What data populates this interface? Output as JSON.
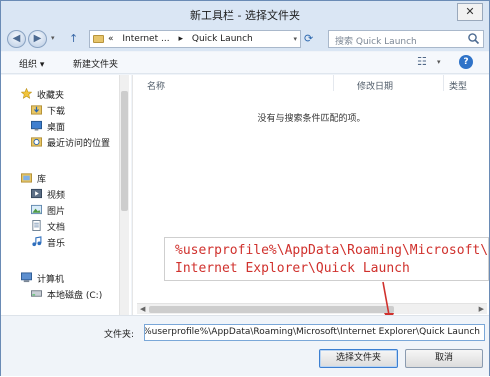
{
  "window": {
    "title": "新工具栏 - 选择文件夹",
    "close_glyph": "✕"
  },
  "address": {
    "crumbs": [
      "«",
      "Internet ...",
      "▸",
      "Quick Launch"
    ],
    "dropdown_glyph": "▾"
  },
  "search": {
    "placeholder": "搜索 Quick Launch"
  },
  "toolbar": {
    "organize": "组织 ▾",
    "new_folder": "新建文件夹",
    "view_glyph": "☷",
    "view_drop": "▾",
    "help": "?"
  },
  "nav": {
    "favorites": {
      "label": "收藏夹",
      "items": [
        "下载",
        "桌面",
        "最近访问的位置"
      ]
    },
    "libraries": {
      "label": "库",
      "items": [
        "视频",
        "图片",
        "文档",
        "音乐"
      ]
    },
    "computer": {
      "label": "计算机",
      "items": [
        "本地磁盘 (C:)"
      ]
    }
  },
  "columns": [
    "名称",
    "修改日期",
    "类型"
  ],
  "empty_message": "没有与搜索条件匹配的项。",
  "annotation": {
    "line1": "%userprofile%\\AppData\\Roaming\\Microsoft\\",
    "line2": "Internet Explorer\\Quick Launch"
  },
  "folder_field": {
    "label": "文件夹:",
    "value": "%userprofile%\\AppData\\Roaming\\Microsoft\\Internet Explorer\\Quick Launch"
  },
  "buttons": {
    "select": "选择文件夹",
    "cancel": "取消"
  },
  "colors": {
    "accent": "#3c7fd1",
    "annotation": "#d0312d"
  }
}
